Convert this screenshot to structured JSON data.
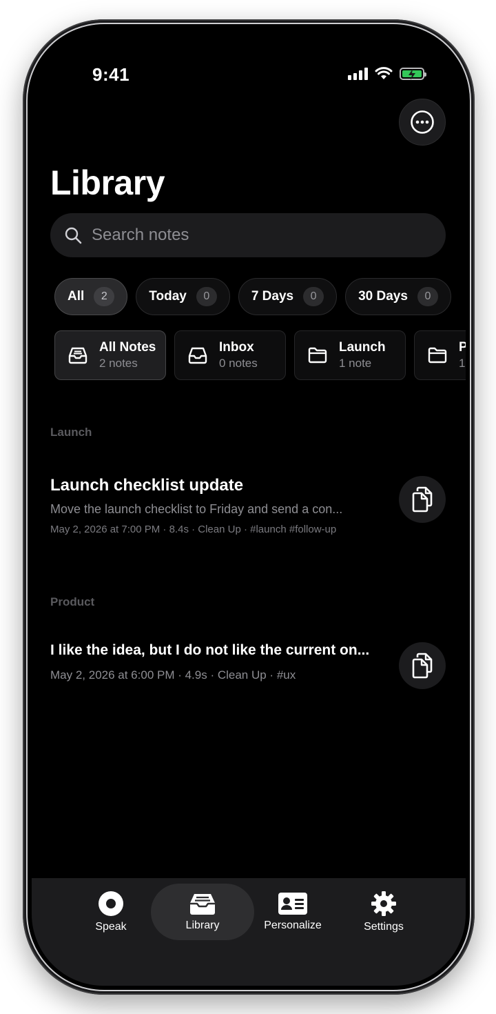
{
  "status_bar": {
    "time": "9:41"
  },
  "header": {
    "title": "Library",
    "more_icon": "ellipsis-circle-icon"
  },
  "search": {
    "placeholder": "Search notes",
    "value": ""
  },
  "filters": [
    {
      "label": "All",
      "count": "2",
      "active": true
    },
    {
      "label": "Today",
      "count": "0",
      "active": false
    },
    {
      "label": "7 Days",
      "count": "0",
      "active": false
    },
    {
      "label": "30 Days",
      "count": "0",
      "active": false
    }
  ],
  "folders": [
    {
      "name": "All Notes",
      "count": "2 notes",
      "icon": "tray-icon",
      "active": true
    },
    {
      "name": "Inbox",
      "count": "0 notes",
      "icon": "tray-icon",
      "active": false
    },
    {
      "name": "Launch",
      "count": "1 note",
      "icon": "folder-icon",
      "active": false
    },
    {
      "name": "P",
      "count": "1",
      "icon": "folder-icon",
      "active": false
    }
  ],
  "sections": [
    {
      "label": "Launch",
      "notes": [
        {
          "title": "Launch checklist update",
          "preview": "Move the launch checklist to Friday and send a con...",
          "meta": "May 2, 2026 at 7:00 PM · 8.4s · Clean Up · #launch #follow-up"
        }
      ]
    },
    {
      "label": "Product",
      "notes": [
        {
          "title": "I like the idea, but I do not like the current on...",
          "meta": "May 2, 2026 at 6:00 PM · 4.9s · Clean Up · #ux"
        }
      ]
    }
  ],
  "tabbar": [
    {
      "label": "Speak",
      "icon": "record-icon",
      "active": false
    },
    {
      "label": "Library",
      "icon": "tray-icon",
      "active": true
    },
    {
      "label": "Personalize",
      "icon": "contact-card-icon",
      "active": false
    },
    {
      "label": "Settings",
      "icon": "gear-icon",
      "active": false
    }
  ],
  "colors": {
    "background": "#000000",
    "surface": "#1c1c1e",
    "battery": "#34c759"
  }
}
